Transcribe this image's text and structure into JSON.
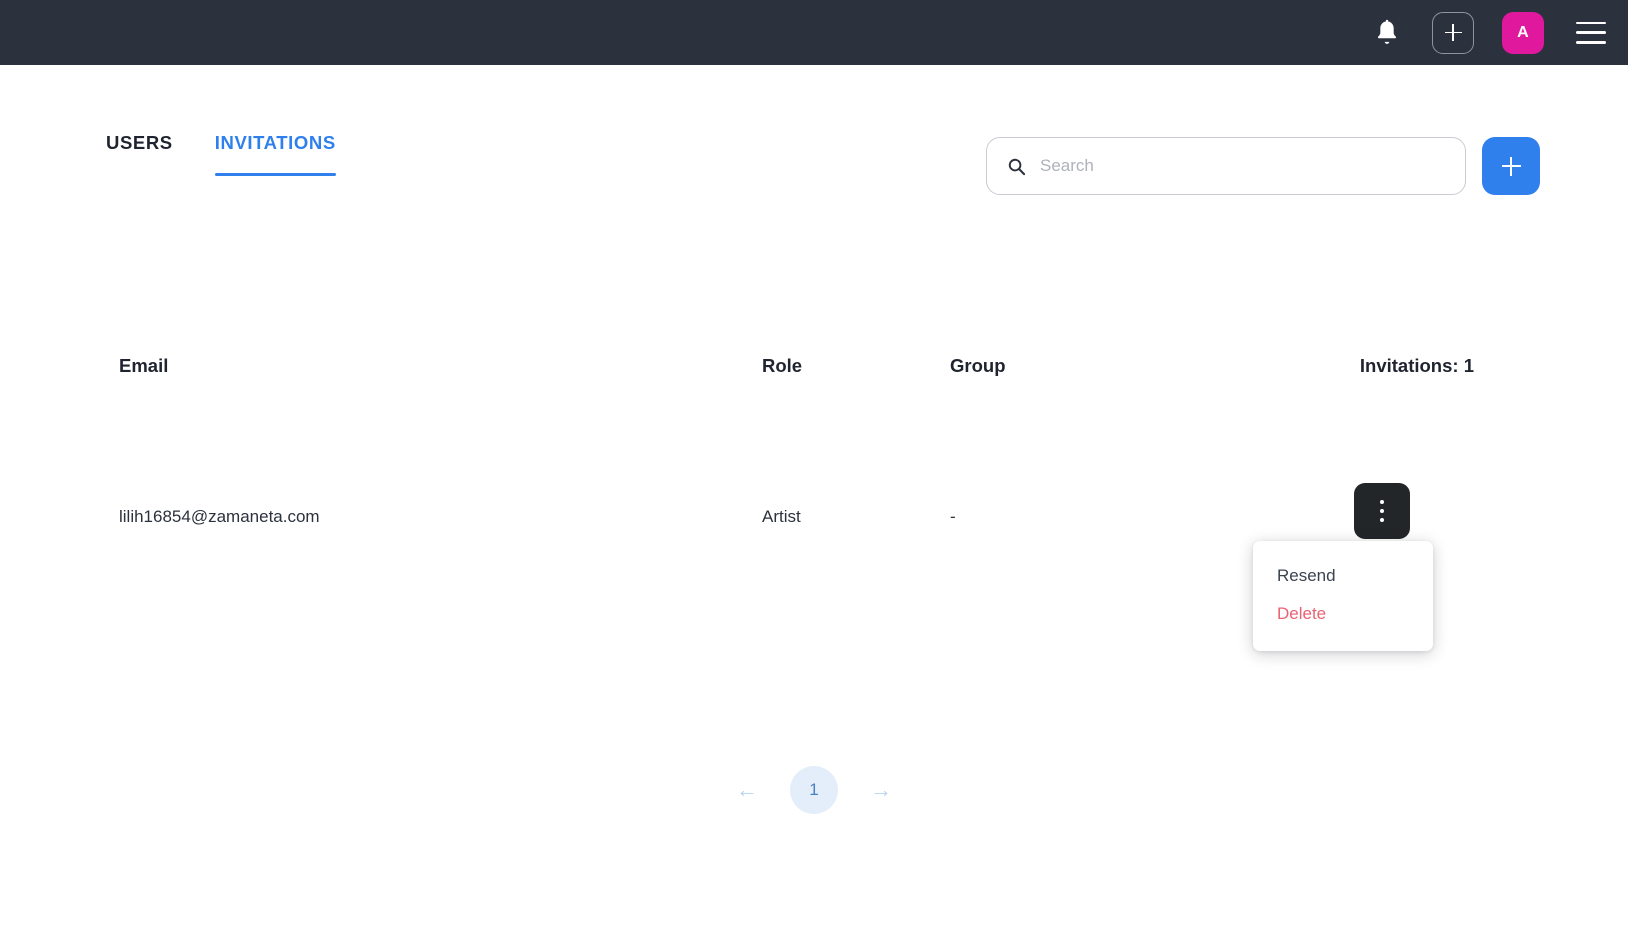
{
  "topbar": {
    "background": "#2b323d",
    "notifications_icon": "bell-icon",
    "create_label": "+",
    "avatar_initial": "A",
    "avatar_color": "#e0189e",
    "menu_icon": "hamburger-icon"
  },
  "tabs": [
    {
      "label": "USERS",
      "active": false
    },
    {
      "label": "INVITATIONS",
      "active": true
    }
  ],
  "search": {
    "placeholder": "Search",
    "value": "",
    "icon": "search-icon"
  },
  "add_button": {
    "label": "+",
    "color": "#2f80ed"
  },
  "table": {
    "headers": {
      "email": "Email",
      "role": "Role",
      "group": "Group",
      "count": "Invitations: 1"
    },
    "rows": [
      {
        "email": "lilih16854@zamaneta.com",
        "role": "Artist",
        "group": "-"
      }
    ]
  },
  "row_menu": {
    "trigger_icon": "kebab-menu-icon",
    "items": [
      {
        "label": "Resend",
        "style": "normal"
      },
      {
        "label": "Delete",
        "style": "danger"
      }
    ]
  },
  "pagination": {
    "prev": "←",
    "current_page": "1",
    "next": "→"
  }
}
